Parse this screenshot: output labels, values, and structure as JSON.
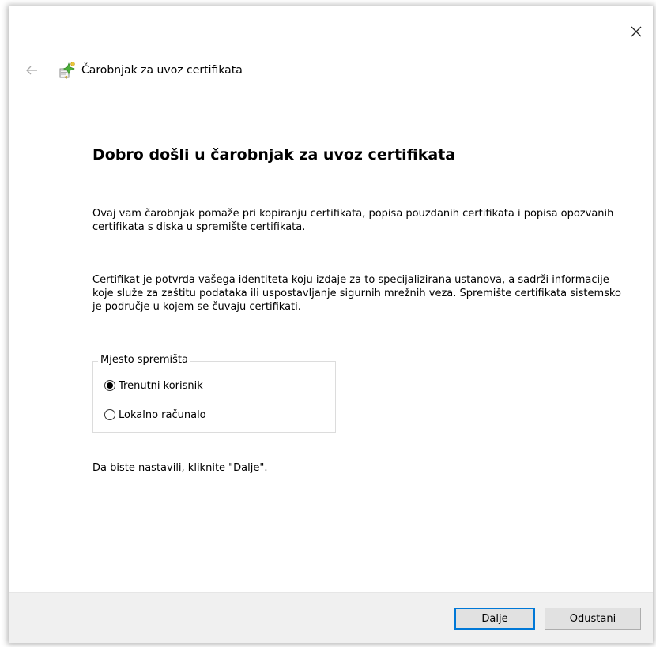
{
  "window": {
    "title": "Čarobnjak za uvoz certifikata",
    "close_icon": "close-icon",
    "back_icon": "back-arrow-icon",
    "wizard_icon": "certificate-wizard-icon"
  },
  "content": {
    "heading": "Dobro došli u čarobnjak za uvoz certifikata",
    "paragraph1": "Ovaj vam čarobnjak pomaže pri kopiranju certifikata, popisa pouzdanih certifikata i popisa opozvanih certifikata s diska u spremište certifikata.",
    "paragraph2": "Certifikat je potvrda vašega identiteta koju izdaje za to specijalizirana ustanova, a sadrži informacije koje služe za zaštitu podataka ili uspostavljanje sigurnih mrežnih veza. Spremište certifikata sistemsko je područje u kojem se čuvaju certifikati.",
    "store_location": {
      "legend": "Mjesto spremišta",
      "options": [
        {
          "label": "Trenutni korisnik",
          "selected": true
        },
        {
          "label": "Lokalno računalo",
          "selected": false
        }
      ]
    },
    "continue_hint": "Da biste nastavili, kliknite \"Dalje\"."
  },
  "footer": {
    "next_label": "Dalje",
    "cancel_label": "Odustani"
  },
  "colors": {
    "accent": "#0078d7",
    "footer_bg": "#f0f0f0",
    "button_bg": "#e1e1e1"
  }
}
